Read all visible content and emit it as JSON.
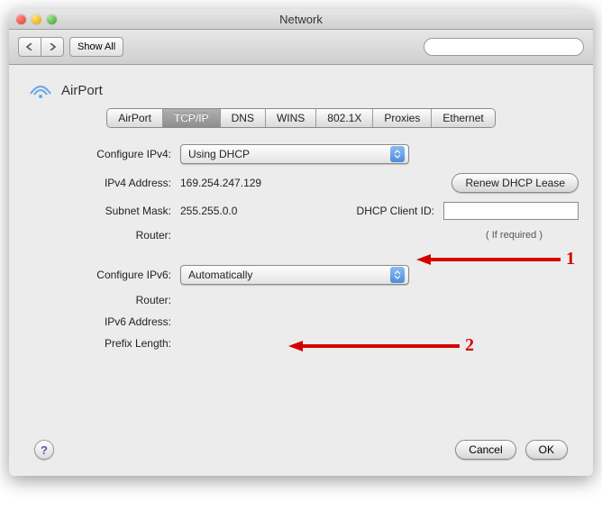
{
  "window_title": "Network",
  "toolbar": {
    "show_all": "Show All",
    "search_placeholder": ""
  },
  "header": {
    "interface_name": "AirPort"
  },
  "tabs": [
    {
      "id": "airport",
      "label": "AirPort",
      "active": false
    },
    {
      "id": "tcpip",
      "label": "TCP/IP",
      "active": true
    },
    {
      "id": "dns",
      "label": "DNS",
      "active": false
    },
    {
      "id": "wins",
      "label": "WINS",
      "active": false
    },
    {
      "id": "8021x",
      "label": "802.1X",
      "active": false
    },
    {
      "id": "proxies",
      "label": "Proxies",
      "active": false
    },
    {
      "id": "ethernet",
      "label": "Ethernet",
      "active": false
    }
  ],
  "form": {
    "configure_ipv4": {
      "label": "Configure IPv4:",
      "value": "Using DHCP"
    },
    "ipv4_address": {
      "label": "IPv4 Address:",
      "value": "169.254.247.129"
    },
    "subnet_mask": {
      "label": "Subnet Mask:",
      "value": "255.255.0.0"
    },
    "router": {
      "label": "Router:",
      "value": ""
    },
    "configure_ipv6": {
      "label": "Configure IPv6:",
      "value": "Automatically"
    },
    "router6": {
      "label": "Router:",
      "value": ""
    },
    "ipv6_address": {
      "label": "IPv6 Address:",
      "value": ""
    },
    "prefix_length": {
      "label": "Prefix Length:",
      "value": ""
    },
    "renew_lease": "Renew DHCP Lease",
    "dhcp_client_id": {
      "label": "DHCP Client ID:",
      "value": ""
    },
    "if_required": "( If required )"
  },
  "footer": {
    "cancel": "Cancel",
    "ok": "OK"
  },
  "annotations": {
    "a1": "1",
    "a2": "2"
  }
}
